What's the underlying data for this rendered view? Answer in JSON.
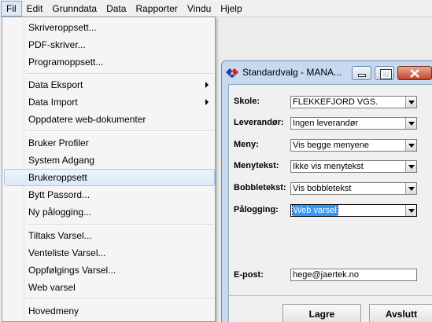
{
  "menubar": {
    "items": [
      "Fil",
      "Edit",
      "Grunndata",
      "Data",
      "Rapporter",
      "Vindu",
      "Hjelp"
    ]
  },
  "dropdown": {
    "items": [
      {
        "label": "Skriveroppsett..."
      },
      {
        "label": "PDF-skriver..."
      },
      {
        "label": "Programoppsett..."
      },
      {
        "label": "Data Eksport"
      },
      {
        "label": "Data Import"
      },
      {
        "label": "Oppdatere web-dokumenter"
      },
      {
        "label": "Bruker Profiler"
      },
      {
        "label": "System Adgang"
      },
      {
        "label": "Brukeroppsett"
      },
      {
        "label": "Bytt Passord..."
      },
      {
        "label": "Ny pålogging..."
      },
      {
        "label": "Tiltaks Varsel..."
      },
      {
        "label": "Venteliste Varsel..."
      },
      {
        "label": "Oppfølgings Varsel..."
      },
      {
        "label": "Web varsel"
      },
      {
        "label": "Hovedmeny"
      }
    ]
  },
  "dialog": {
    "title": "Standardvalg - MANA...",
    "fields": {
      "skole": {
        "label": "Skole:",
        "value": "FLEKKEFJORD VGS."
      },
      "leverandor": {
        "label": "Leverandør:",
        "value": "Ingen leverandør"
      },
      "meny": {
        "label": "Meny:",
        "value": "Vis begge menyene"
      },
      "menytekst": {
        "label": "Menytekst:",
        "value": "Ikke vis menytekst"
      },
      "bobbletekst": {
        "label": "Bobbletekst:",
        "value": "Vis bobbletekst"
      },
      "palogging": {
        "label": "Pålogging:",
        "value": "Web varsel"
      },
      "epost": {
        "label": "E-post:",
        "value": "hege@jaertek.no"
      }
    },
    "buttons": {
      "save": "Lagre",
      "exit": "Avslutt"
    }
  },
  "colors": {
    "menu_highlight": "#dce9f7",
    "dialog_frame": "#c6d9ef",
    "selection": "#3399ff",
    "close_button": "#c2462b"
  },
  "icons": {
    "app_icon": "diamond-logo-icon",
    "submenu_arrow": "chevron-right-icon",
    "combo_arrow": "chevron-down-icon"
  }
}
